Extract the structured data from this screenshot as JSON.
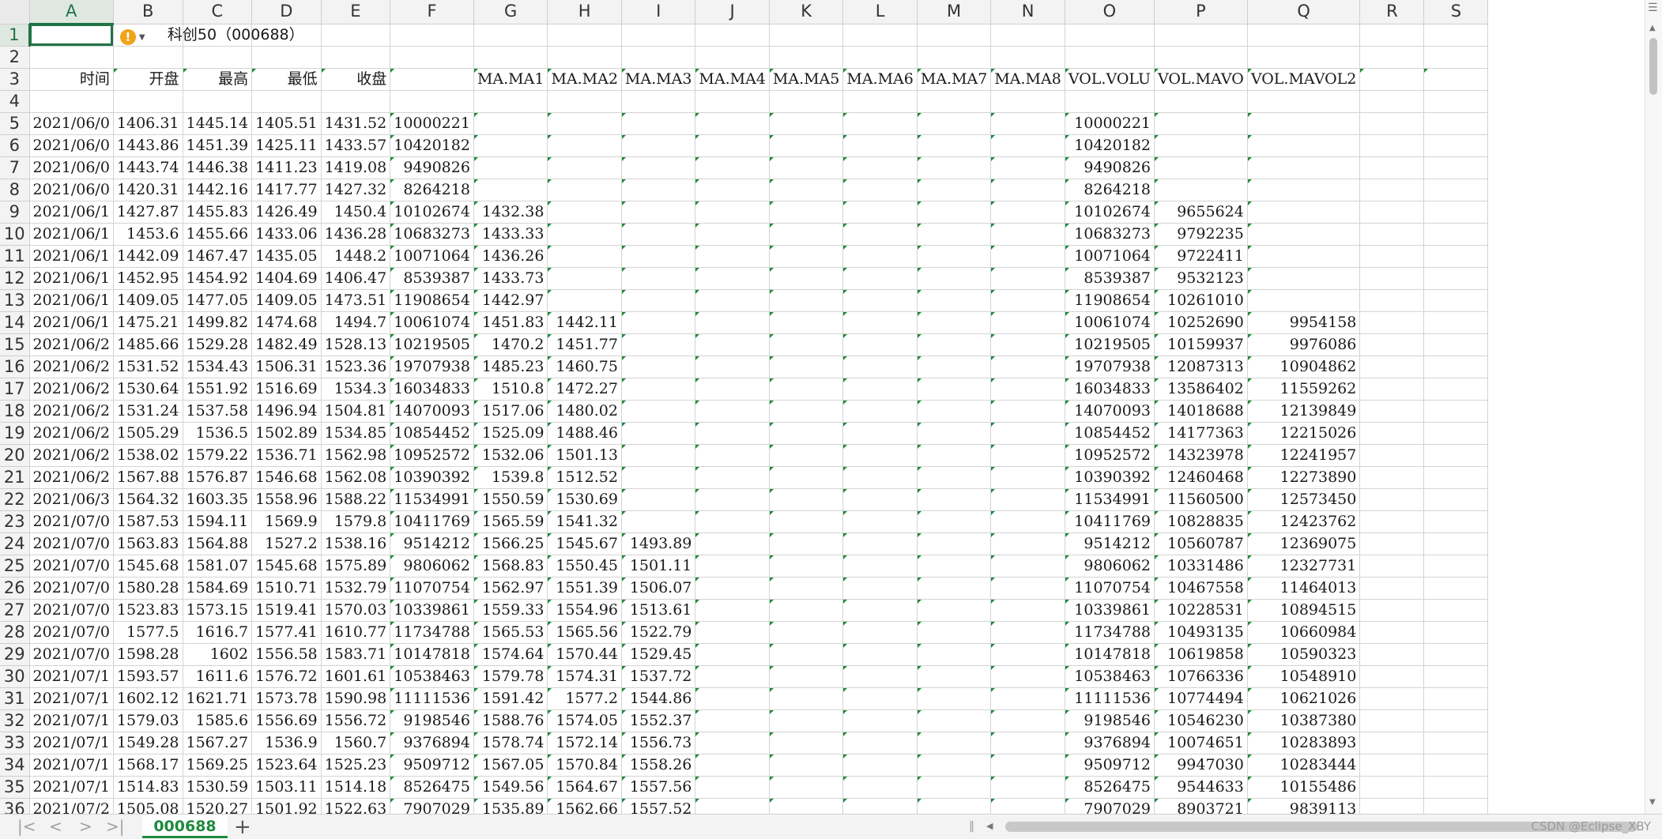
{
  "sheet": {
    "name": "000688",
    "title": "科创50（000688）",
    "selected_cell": "A1",
    "columns": [
      "A",
      "B",
      "C",
      "D",
      "E",
      "F",
      "G",
      "H",
      "I",
      "J",
      "K",
      "L",
      "M",
      "N",
      "O",
      "P",
      "Q",
      "R",
      "S"
    ],
    "header_row": [
      "时间",
      "开盘",
      "最高",
      "最低",
      "收盘",
      "",
      "MA.MA1",
      "MA.MA2",
      "MA.MA3",
      "MA.MA4",
      "MA.MA5",
      "MA.MA6",
      "MA.MA7",
      "MA.MA8",
      "VOL.VOLU",
      "VOL.MAVO",
      "VOL.MAVOL2",
      "",
      ""
    ],
    "rows": [
      {
        "n": 5,
        "c": [
          "2021/06/0",
          "1406.31",
          "1445.14",
          "1405.51",
          "1431.52",
          "10000221",
          "",
          "",
          "",
          "",
          "",
          "",
          "",
          "",
          "10000221",
          "",
          ""
        ]
      },
      {
        "n": 6,
        "c": [
          "2021/06/0",
          "1443.86",
          "1451.39",
          "1425.11",
          "1433.57",
          "10420182",
          "",
          "",
          "",
          "",
          "",
          "",
          "",
          "",
          "10420182",
          "",
          ""
        ]
      },
      {
        "n": 7,
        "c": [
          "2021/06/0",
          "1443.74",
          "1446.38",
          "1411.23",
          "1419.08",
          "9490826",
          "",
          "",
          "",
          "",
          "",
          "",
          "",
          "",
          "9490826",
          "",
          ""
        ]
      },
      {
        "n": 8,
        "c": [
          "2021/06/0",
          "1420.31",
          "1442.16",
          "1417.77",
          "1427.32",
          "8264218",
          "",
          "",
          "",
          "",
          "",
          "",
          "",
          "",
          "8264218",
          "",
          ""
        ]
      },
      {
        "n": 9,
        "c": [
          "2021/06/1",
          "1427.87",
          "1455.83",
          "1426.49",
          "1450.4",
          "10102674",
          "1432.38",
          "",
          "",
          "",
          "",
          "",
          "",
          "",
          "10102674",
          "9655624",
          ""
        ]
      },
      {
        "n": 10,
        "c": [
          "2021/06/1",
          "1453.6",
          "1455.66",
          "1433.06",
          "1436.28",
          "10683273",
          "1433.33",
          "",
          "",
          "",
          "",
          "",
          "",
          "",
          "10683273",
          "9792235",
          ""
        ]
      },
      {
        "n": 11,
        "c": [
          "2021/06/1",
          "1442.09",
          "1467.47",
          "1435.05",
          "1448.2",
          "10071064",
          "1436.26",
          "",
          "",
          "",
          "",
          "",
          "",
          "",
          "10071064",
          "9722411",
          ""
        ]
      },
      {
        "n": 12,
        "c": [
          "2021/06/1",
          "1452.95",
          "1454.92",
          "1404.69",
          "1406.47",
          "8539387",
          "1433.73",
          "",
          "",
          "",
          "",
          "",
          "",
          "",
          "8539387",
          "9532123",
          ""
        ]
      },
      {
        "n": 13,
        "c": [
          "2021/06/1",
          "1409.05",
          "1477.05",
          "1409.05",
          "1473.51",
          "11908654",
          "1442.97",
          "",
          "",
          "",
          "",
          "",
          "",
          "",
          "11908654",
          "10261010",
          ""
        ]
      },
      {
        "n": 14,
        "c": [
          "2021/06/1",
          "1475.21",
          "1499.82",
          "1474.68",
          "1494.7",
          "10061074",
          "1451.83",
          "1442.11",
          "",
          "",
          "",
          "",
          "",
          "",
          "10061074",
          "10252690",
          "9954158"
        ]
      },
      {
        "n": 15,
        "c": [
          "2021/06/2",
          "1485.66",
          "1529.28",
          "1482.49",
          "1528.13",
          "10219505",
          "1470.2",
          "1451.77",
          "",
          "",
          "",
          "",
          "",
          "",
          "10219505",
          "10159937",
          "9976086"
        ]
      },
      {
        "n": 16,
        "c": [
          "2021/06/2",
          "1531.52",
          "1534.43",
          "1506.31",
          "1523.36",
          "19707938",
          "1485.23",
          "1460.75",
          "",
          "",
          "",
          "",
          "",
          "",
          "19707938",
          "12087313",
          "10904862"
        ]
      },
      {
        "n": 17,
        "c": [
          "2021/06/2",
          "1530.64",
          "1551.92",
          "1516.69",
          "1534.3",
          "16034833",
          "1510.8",
          "1472.27",
          "",
          "",
          "",
          "",
          "",
          "",
          "16034833",
          "13586402",
          "11559262"
        ]
      },
      {
        "n": 18,
        "c": [
          "2021/06/2",
          "1531.24",
          "1537.58",
          "1496.94",
          "1504.81",
          "14070093",
          "1517.06",
          "1480.02",
          "",
          "",
          "",
          "",
          "",
          "",
          "14070093",
          "14018688",
          "12139849"
        ]
      },
      {
        "n": 19,
        "c": [
          "2021/06/2",
          "1505.29",
          "1536.5",
          "1502.89",
          "1534.85",
          "10854452",
          "1525.09",
          "1488.46",
          "",
          "",
          "",
          "",
          "",
          "",
          "10854452",
          "14177363",
          "12215026"
        ]
      },
      {
        "n": 20,
        "c": [
          "2021/06/2",
          "1538.02",
          "1579.22",
          "1536.71",
          "1562.98",
          "10952572",
          "1532.06",
          "1501.13",
          "",
          "",
          "",
          "",
          "",
          "",
          "10952572",
          "14323978",
          "12241957"
        ]
      },
      {
        "n": 21,
        "c": [
          "2021/06/2",
          "1567.88",
          "1576.87",
          "1546.68",
          "1562.08",
          "10390392",
          "1539.8",
          "1512.52",
          "",
          "",
          "",
          "",
          "",
          "",
          "10390392",
          "12460468",
          "12273890"
        ]
      },
      {
        "n": 22,
        "c": [
          "2021/06/3",
          "1564.32",
          "1603.35",
          "1558.96",
          "1588.22",
          "11534991",
          "1550.59",
          "1530.69",
          "",
          "",
          "",
          "",
          "",
          "",
          "11534991",
          "11560500",
          "12573450"
        ]
      },
      {
        "n": 23,
        "c": [
          "2021/07/0",
          "1587.53",
          "1594.11",
          "1569.9",
          "1579.8",
          "10411769",
          "1565.59",
          "1541.32",
          "",
          "",
          "",
          "",
          "",
          "",
          "10411769",
          "10828835",
          "12423762"
        ]
      },
      {
        "n": 24,
        "c": [
          "2021/07/0",
          "1563.83",
          "1564.88",
          "1527.2",
          "1538.16",
          "9514212",
          "1566.25",
          "1545.67",
          "1493.89",
          "",
          "",
          "",
          "",
          "",
          "9514212",
          "10560787",
          "12369075"
        ]
      },
      {
        "n": 25,
        "c": [
          "2021/07/0",
          "1545.68",
          "1581.07",
          "1545.68",
          "1575.89",
          "9806062",
          "1568.83",
          "1550.45",
          "1501.11",
          "",
          "",
          "",
          "",
          "",
          "9806062",
          "10331486",
          "12327731"
        ]
      },
      {
        "n": 26,
        "c": [
          "2021/07/0",
          "1580.28",
          "1584.69",
          "1510.71",
          "1532.79",
          "11070754",
          "1562.97",
          "1551.39",
          "1506.07",
          "",
          "",
          "",
          "",
          "",
          "11070754",
          "10467558",
          "11464013"
        ]
      },
      {
        "n": 27,
        "c": [
          "2021/07/0",
          "1523.83",
          "1573.15",
          "1519.41",
          "1570.03",
          "10339861",
          "1559.33",
          "1554.96",
          "1513.61",
          "",
          "",
          "",
          "",
          "",
          "10339861",
          "10228531",
          "10894515"
        ]
      },
      {
        "n": 28,
        "c": [
          "2021/07/0",
          "1577.5",
          "1616.7",
          "1577.41",
          "1610.77",
          "11734788",
          "1565.53",
          "1565.56",
          "1522.79",
          "",
          "",
          "",
          "",
          "",
          "11734788",
          "10493135",
          "10660984"
        ]
      },
      {
        "n": 29,
        "c": [
          "2021/07/0",
          "1598.28",
          "1602",
          "1556.58",
          "1583.71",
          "10147818",
          "1574.64",
          "1570.44",
          "1529.45",
          "",
          "",
          "",
          "",
          "",
          "10147818",
          "10619858",
          "10590323"
        ]
      },
      {
        "n": 30,
        "c": [
          "2021/07/1",
          "1593.57",
          "1611.6",
          "1576.72",
          "1601.61",
          "10538463",
          "1579.78",
          "1574.31",
          "1537.72",
          "",
          "",
          "",
          "",
          "",
          "10538463",
          "10766336",
          "10548910"
        ]
      },
      {
        "n": 31,
        "c": [
          "2021/07/1",
          "1602.12",
          "1621.71",
          "1573.78",
          "1590.98",
          "11111536",
          "1591.42",
          "1577.2",
          "1544.86",
          "",
          "",
          "",
          "",
          "",
          "11111536",
          "10774494",
          "10621026"
        ]
      },
      {
        "n": 32,
        "c": [
          "2021/07/1",
          "1579.03",
          "1585.6",
          "1556.69",
          "1556.72",
          "9198546",
          "1588.76",
          "1574.05",
          "1552.37",
          "",
          "",
          "",
          "",
          "",
          "9198546",
          "10546230",
          "10387380"
        ]
      },
      {
        "n": 33,
        "c": [
          "2021/07/1",
          "1549.28",
          "1567.27",
          "1536.9",
          "1560.7",
          "9376894",
          "1578.74",
          "1572.14",
          "1556.73",
          "",
          "",
          "",
          "",
          "",
          "9376894",
          "10074651",
          "10283893"
        ]
      },
      {
        "n": 34,
        "c": [
          "2021/07/1",
          "1568.17",
          "1569.25",
          "1523.64",
          "1525.23",
          "9509712",
          "1567.05",
          "1570.84",
          "1558.26",
          "",
          "",
          "",
          "",
          "",
          "9509712",
          "9947030",
          "10283444"
        ]
      },
      {
        "n": 35,
        "c": [
          "2021/07/1",
          "1514.83",
          "1530.59",
          "1503.11",
          "1514.18",
          "8526475",
          "1549.56",
          "1564.67",
          "1557.56",
          "",
          "",
          "",
          "",
          "",
          "8526475",
          "9544633",
          "10155486"
        ]
      },
      {
        "n": 36,
        "c": [
          "2021/07/2",
          "1505.08",
          "1520.27",
          "1501.92",
          "1522.63",
          "7907029",
          "1535.89",
          "1562.66",
          "1557.52",
          "",
          "",
          "",
          "",
          "",
          "7907029",
          "8903721",
          "9839113"
        ]
      }
    ]
  },
  "ui": {
    "watermark": "CSDN @Eclipse_XBY",
    "add_tab_symbol": "+",
    "nav_first": "|<",
    "nav_prev": "<",
    "nav_next": ">",
    "nav_last": ">|",
    "warning_symbol": "!",
    "accent_color": "#217346",
    "tab_color": "#1e8a3c"
  }
}
